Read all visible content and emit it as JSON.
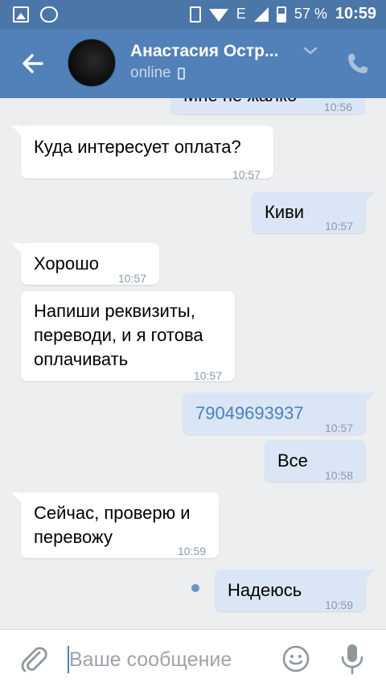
{
  "status_bar": {
    "network_label": "E",
    "battery_percent": "57 %",
    "time": "10:59"
  },
  "header": {
    "contact_name": "Анастасия Остр...",
    "status": "online"
  },
  "messages": [
    {
      "direction": "out",
      "text": "Мне не жалко",
      "time": "10:56"
    },
    {
      "direction": "in",
      "text": "Куда интересует оплата?",
      "time": "10:57"
    },
    {
      "direction": "out",
      "text": "Киви",
      "time": "10:57"
    },
    {
      "direction": "in",
      "text": "Хорошо",
      "time": "10:57"
    },
    {
      "direction": "in",
      "text": "Напиши реквизиты,\nпереводи, и я готова\nоплачивать",
      "time": "10:57"
    },
    {
      "direction": "out",
      "text": "79049693937",
      "time": "10:57"
    },
    {
      "direction": "out",
      "text": "Все",
      "time": "10:58"
    },
    {
      "direction": "in",
      "text": "Сейчас, проверю и\nперевожу",
      "time": "10:59"
    },
    {
      "direction": "out",
      "text": "Надеюсь",
      "time": "10:59"
    }
  ],
  "composer": {
    "placeholder": "Ваше сообщение"
  },
  "colors": {
    "header_bg": "#5181b8",
    "status_bar_bg": "#4a76a8",
    "chat_bg": "#edeef0",
    "incoming_bubble": "#ffffff",
    "outgoing_bubble": "#dae6f5",
    "link": "#4a80bd"
  },
  "icons": {
    "back": "arrow-left-icon",
    "call": "phone-icon",
    "attach": "paperclip-icon",
    "emoji": "smiley-icon",
    "mic": "microphone-icon"
  }
}
